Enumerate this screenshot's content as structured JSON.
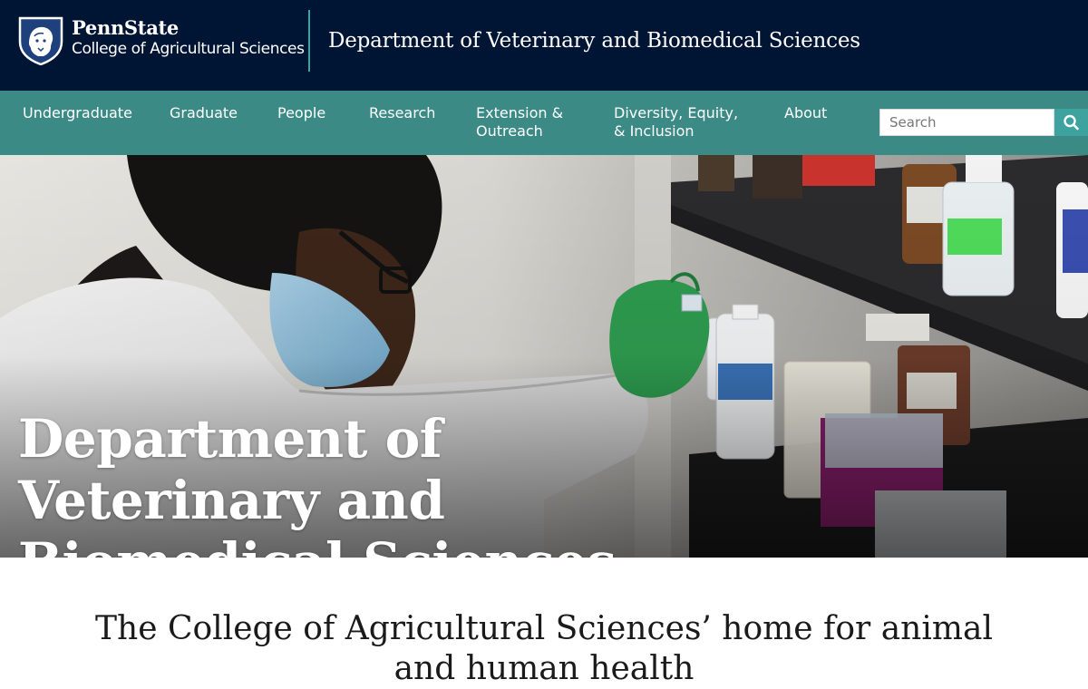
{
  "header": {
    "brand_name": "PennState",
    "brand_college": "College of Agricultural Sciences",
    "department_title": "Department of Veterinary and Biomedical Sciences",
    "logo_icon": "nittany-lion-shield-icon",
    "colors": {
      "header_bg": "#001433",
      "nav_bg": "#3b8a86",
      "accent": "#3ea39e"
    }
  },
  "nav": {
    "items": [
      {
        "label": "Undergraduate"
      },
      {
        "label": "Graduate"
      },
      {
        "label": "People"
      },
      {
        "label": "Research"
      },
      {
        "label": "Extension & Outreach"
      },
      {
        "label": "Diversity, Equity, & Inclusion"
      },
      {
        "label": "About"
      }
    ],
    "search": {
      "placeholder": "Search",
      "button_icon": "search-icon"
    }
  },
  "hero": {
    "title": "Department of Veterinary and Biomedical Sciences",
    "image_subject": "lab-researcher-photo"
  },
  "intro": {
    "tagline": "The College of Agricultural Sciences’ home for animal and human health"
  }
}
